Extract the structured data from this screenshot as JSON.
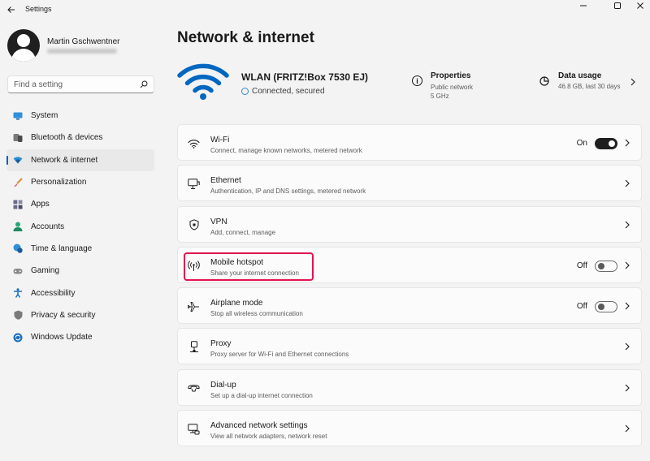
{
  "window": {
    "title": "Settings"
  },
  "user": {
    "name": "Martin Gschwentner"
  },
  "search": {
    "placeholder": "Find a setting"
  },
  "sidebar": {
    "items": [
      {
        "label": "System",
        "icon": "monitor-icon",
        "active": false
      },
      {
        "label": "Bluetooth & devices",
        "icon": "bluetooth-icon",
        "active": false
      },
      {
        "label": "Network & internet",
        "icon": "wifi-diamond-icon",
        "active": true
      },
      {
        "label": "Personalization",
        "icon": "brush-icon",
        "active": false
      },
      {
        "label": "Apps",
        "icon": "apps-icon",
        "active": false
      },
      {
        "label": "Accounts",
        "icon": "person-icon",
        "active": false
      },
      {
        "label": "Time & language",
        "icon": "globe-clock-icon",
        "active": false
      },
      {
        "label": "Gaming",
        "icon": "gamepad-icon",
        "active": false
      },
      {
        "label": "Accessibility",
        "icon": "accessibility-icon",
        "active": false
      },
      {
        "label": "Privacy & security",
        "icon": "shield-icon",
        "active": false
      },
      {
        "label": "Windows Update",
        "icon": "update-icon",
        "active": false
      }
    ]
  },
  "main": {
    "title": "Network & internet",
    "connection": {
      "name": "WLAN (FRITZ!Box 7530 EJ)",
      "status": "Connected, secured"
    },
    "properties": {
      "title": "Properties",
      "line1": "Public network",
      "line2": "5 GHz"
    },
    "data_usage": {
      "title": "Data usage",
      "detail": "46.8 GB, last 30 days"
    },
    "cards": [
      {
        "title": "Wi-Fi",
        "subtitle": "Connect, manage known networks, metered network",
        "icon": "wifi-icon",
        "toggle": "On"
      },
      {
        "title": "Ethernet",
        "subtitle": "Authentication, IP and DNS settings, metered network",
        "icon": "ethernet-icon"
      },
      {
        "title": "VPN",
        "subtitle": "Add, connect, manage",
        "icon": "vpn-shield-icon"
      },
      {
        "title": "Mobile hotspot",
        "subtitle": "Share your internet connection",
        "icon": "hotspot-icon",
        "toggle": "Off"
      },
      {
        "title": "Airplane mode",
        "subtitle": "Stop all wireless communication",
        "icon": "airplane-icon",
        "toggle": "Off"
      },
      {
        "title": "Proxy",
        "subtitle": "Proxy server for Wi-Fi and Ethernet connections",
        "icon": "proxy-icon"
      },
      {
        "title": "Dial-up",
        "subtitle": "Set up a dial-up internet connection",
        "icon": "dialup-icon"
      },
      {
        "title": "Advanced network settings",
        "subtitle": "View all network adapters, network reset",
        "icon": "network-adapter-icon"
      }
    ]
  },
  "colors": {
    "accent": "#005fb8",
    "wifi_blue": "#0067c0",
    "highlight": "#e2144e"
  }
}
